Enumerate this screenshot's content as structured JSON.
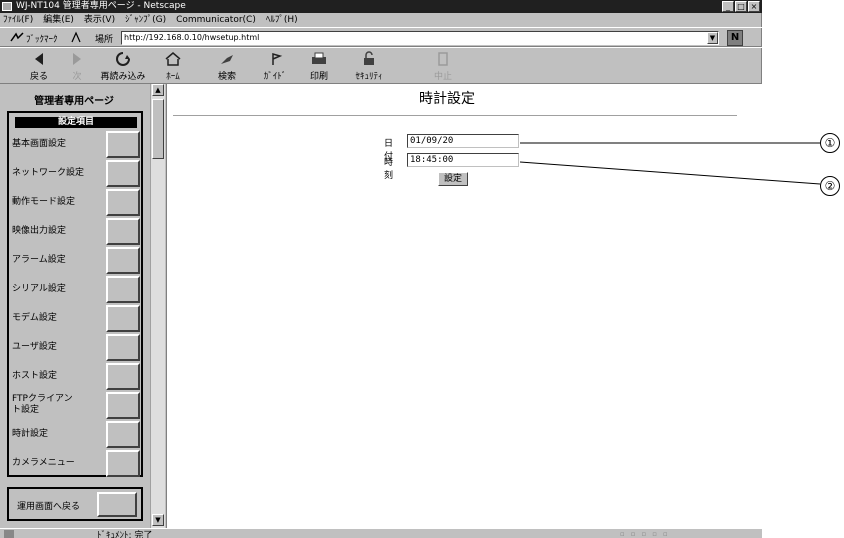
{
  "window": {
    "title": "WJ-NT104 管理者専用ページ - Netscape",
    "controls": [
      "_",
      "□",
      "×"
    ]
  },
  "menubar": {
    "items": [
      "ﾌｧｲﾙ(F)",
      "編集(E)",
      "表示(V)",
      "ｼﾞｬﾝﾌﾟ(G)",
      "Communicator(C)",
      "ﾍﾙﾌﾟ(H)"
    ]
  },
  "location": {
    "bookmarks_label": "ﾌﾞｯｸﾏｰｸ",
    "location_label": "場所",
    "url": "http://192.168.0.10/hwsetup.html"
  },
  "toolbar": {
    "buttons": [
      {
        "label": "戻る",
        "icon": "back-arrow-icon",
        "enabled": true
      },
      {
        "label": "次",
        "icon": "forward-arrow-icon",
        "enabled": false
      },
      {
        "label": "再読み込み",
        "icon": "reload-icon",
        "enabled": true
      },
      {
        "label": "ﾎｰﾑ",
        "icon": "home-icon",
        "enabled": true
      },
      {
        "label": "検索",
        "icon": "search-icon",
        "enabled": true
      },
      {
        "label": "ｶﾞｲﾄﾞ",
        "icon": "guide-icon",
        "enabled": true
      },
      {
        "label": "印刷",
        "icon": "print-icon",
        "enabled": true
      },
      {
        "label": "ｾｷｭﾘﾃｨ",
        "icon": "security-icon",
        "enabled": true
      },
      {
        "label": "中止",
        "icon": "stop-icon",
        "enabled": false
      }
    ]
  },
  "left": {
    "title": "管理者専用ページ",
    "menu_heading": "設定項目",
    "items": [
      {
        "label": "基本画面設定"
      },
      {
        "label": "ネットワーク設定"
      },
      {
        "label": "動作モード設定"
      },
      {
        "label": "映像出力設定"
      },
      {
        "label": "アラーム設定"
      },
      {
        "label": "シリアル設定"
      },
      {
        "label": "モデム設定"
      },
      {
        "label": "ユーザ設定"
      },
      {
        "label": "ホスト設定"
      },
      {
        "label": "FTPクライアント設定"
      },
      {
        "label": "時計設定"
      },
      {
        "label": "カメラメニュー"
      }
    ],
    "back_label": "運用画面へ戻る"
  },
  "main": {
    "title": "時計設定",
    "date_label": "日付",
    "date_value": "01/09/20",
    "time_label": "時刻",
    "time_value": "18:45:00",
    "submit_label": "設定"
  },
  "status": {
    "text": "ﾄﾞｷｭﾒﾝﾄ: 完了"
  },
  "callouts": [
    "①",
    "②"
  ]
}
